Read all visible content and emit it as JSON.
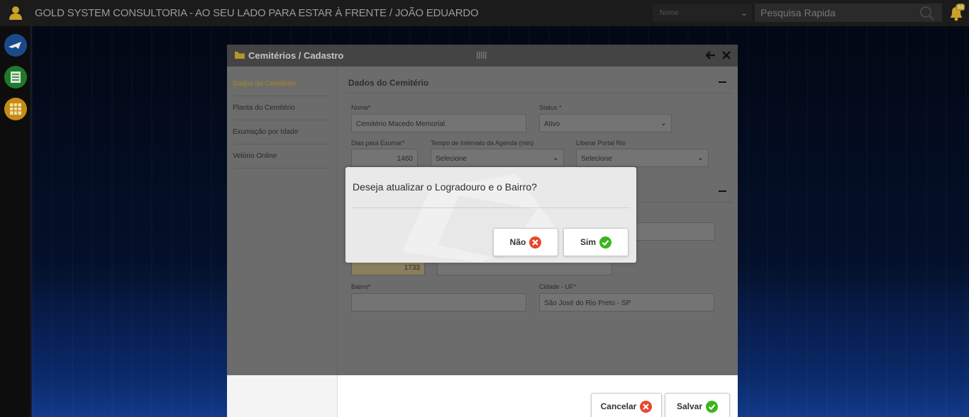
{
  "topbar": {
    "title": "GOLD SYSTEM CONSULTORIA - AO SEU LADO PARA ESTAR À FRENTE / JOÃO EDUARDO",
    "search_field_select": "Nome",
    "search_placeholder": "Pesquisa Rapida",
    "notification_count": "88"
  },
  "modal": {
    "title": "Cemitérios / Cadastro",
    "nav": [
      {
        "label": "Dados do Cemitério",
        "active": true
      },
      {
        "label": "Planta do Cemitério"
      },
      {
        "label": "Exumação por Idade"
      },
      {
        "label": "Velório Online"
      }
    ],
    "section1": {
      "title": "Dados do Cemitério",
      "nome_label": "Nome*",
      "nome_value": "Cemitério Macedo Memorial",
      "status_label": "Status *",
      "status_value": "Ativo",
      "dias_label": "Dias para Exumar*",
      "dias_value": "1460",
      "tempo_label": "Tempo de Intervalo da Agenda (min)",
      "tempo_value": "Selecione",
      "liberar_label": "Liberar Portal Rio",
      "liberar_value": "Selecione"
    },
    "section2": {
      "numero_value": "1733",
      "bairro_label": "Bairro*",
      "bairro_value": "",
      "cidade_label": "Cidade - UF*",
      "cidade_value": "São José do Rio Preto - SP"
    },
    "footer": {
      "cancel_label": "Cancelar",
      "save_label": "Salvar"
    }
  },
  "dialog": {
    "message": "Deseja atualizar o Logradouro e o Bairro?",
    "no_label": "Não",
    "yes_label": "Sim"
  },
  "colors": {
    "accent_gold": "#a9891f",
    "cancel_red": "#e8462b",
    "confirm_green": "#3bb51d"
  }
}
